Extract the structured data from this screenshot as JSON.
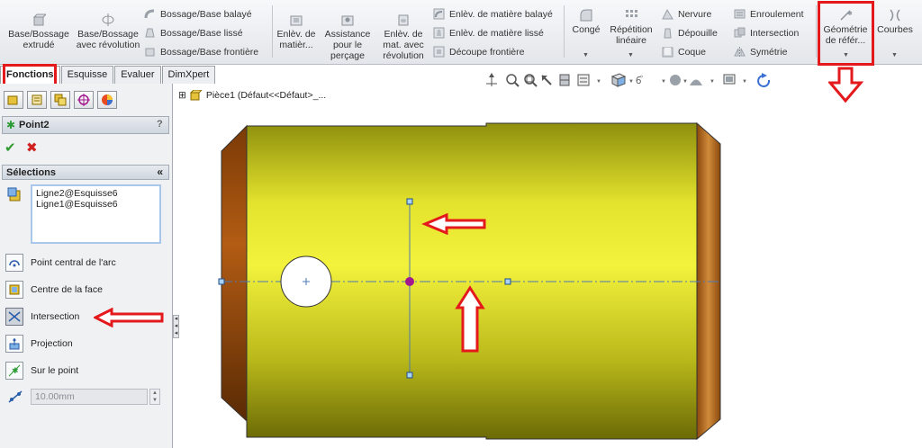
{
  "ribbon": {
    "base_extrude": "Base/Bossage extrudé",
    "base_revolve": "Base/Bossage avec révolution",
    "boss_sweep": "Bossage/Base balayé",
    "boss_loft": "Bossage/Base lissé",
    "boss_boundary": "Bossage/Base frontière",
    "cut_extrude": "Enlèv. de matièr...",
    "hole_wizard": "Assistance pour le perçage",
    "cut_revolve": "Enlèv. de mat. avec révolution",
    "cut_sweep": "Enlèv. de matière balayé",
    "cut_loft": "Enlèv. de matière lissé",
    "cut_boundary": "Découpe frontière",
    "fillet": "Congé",
    "linear_pattern": "Répétition linéaire",
    "rib": "Nervure",
    "draft": "Dépouille",
    "shell": "Coque",
    "wrap": "Enroulement",
    "intersect": "Intersection",
    "mirror": "Symétrie",
    "ref_geometry": "Géométrie de référ...",
    "curves": "Courbes"
  },
  "tabs": [
    {
      "label": "Fonctions",
      "active": true
    },
    {
      "label": "Esquisse",
      "active": false
    },
    {
      "label": "Evaluer",
      "active": false
    },
    {
      "label": "DimXpert",
      "active": false
    }
  ],
  "panel": {
    "title": "Point2",
    "help": "?",
    "ok": "✔",
    "cancel": "✖",
    "section_title": "Sélections",
    "collapse": "«",
    "selections": [
      "Ligne2@Esquisse6",
      "Ligne1@Esquisse6"
    ],
    "options": [
      {
        "label": "Point central de l'arc",
        "selected": false
      },
      {
        "label": "Centre de la face",
        "selected": false
      },
      {
        "label": "Intersection",
        "selected": true
      },
      {
        "label": "Projection",
        "selected": false
      },
      {
        "label": "Sur le point",
        "selected": false
      }
    ],
    "distance_value": "10.00mm"
  },
  "tree": {
    "expand": "⊞",
    "label": "Pièce1  (Défaut<<Défaut>_..."
  },
  "colors": {
    "annotation_red": "#e3191c",
    "part_yellow": "#c9c81a",
    "chamfer_brown": "#9a4a0c",
    "point_magenta": "#a3178f",
    "sketch_line": "#4a78b5"
  }
}
